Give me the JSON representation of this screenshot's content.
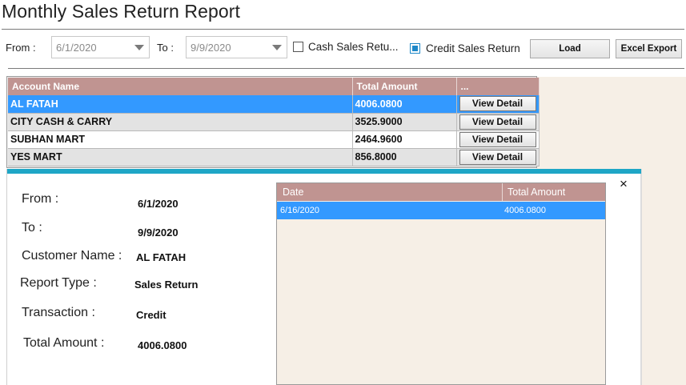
{
  "window": {
    "title": "Monthly Sales Return Report"
  },
  "filters": {
    "from_label": "From :",
    "from_value": "6/1/2020",
    "to_label": "To :",
    "to_value": "9/9/2020",
    "cash_label": "Cash Sales Retu...",
    "cash_checked": false,
    "credit_label": "Credit Sales Return",
    "credit_checked": true,
    "load_label": "Load",
    "export_label": "Excel Export"
  },
  "grid": {
    "headers": [
      "Account Name",
      "Total Amount",
      "..."
    ],
    "rows": [
      {
        "name": "AL FATAH",
        "amount": "4006.0800",
        "action": "View Detail",
        "selected": true
      },
      {
        "name": "CITY CASH & CARRY",
        "amount": "3525.9000",
        "action": "View Detail",
        "selected": false
      },
      {
        "name": "SUBHAN MART",
        "amount": "2464.9600",
        "action": "View Detail",
        "selected": false
      },
      {
        "name": "YES MART",
        "amount": "856.8000",
        "action": "View Detail",
        "selected": false
      }
    ]
  },
  "detail": {
    "close_glyph": "×",
    "from_label": "From :",
    "from_value": "6/1/2020",
    "to_label": "To :",
    "to_value": "9/9/2020",
    "customer_label": "Customer Name :",
    "customer_value": "AL FATAH",
    "report_type_label": "Report Type :",
    "report_type_value": "Sales Return",
    "transaction_label": "Transaction :",
    "transaction_value": "Credit",
    "total_label": "Total Amount :",
    "total_value": "4006.0800",
    "table_headers": [
      "Date",
      "Total Amount"
    ],
    "table_rows": [
      {
        "date": "6/16/2020",
        "amount": "4006.0800"
      }
    ]
  },
  "colors": {
    "header_bg": "#c09491",
    "selection": "#3399ff",
    "accent_bar": "#1ea6c6",
    "panel_bg": "#f6efe6"
  }
}
